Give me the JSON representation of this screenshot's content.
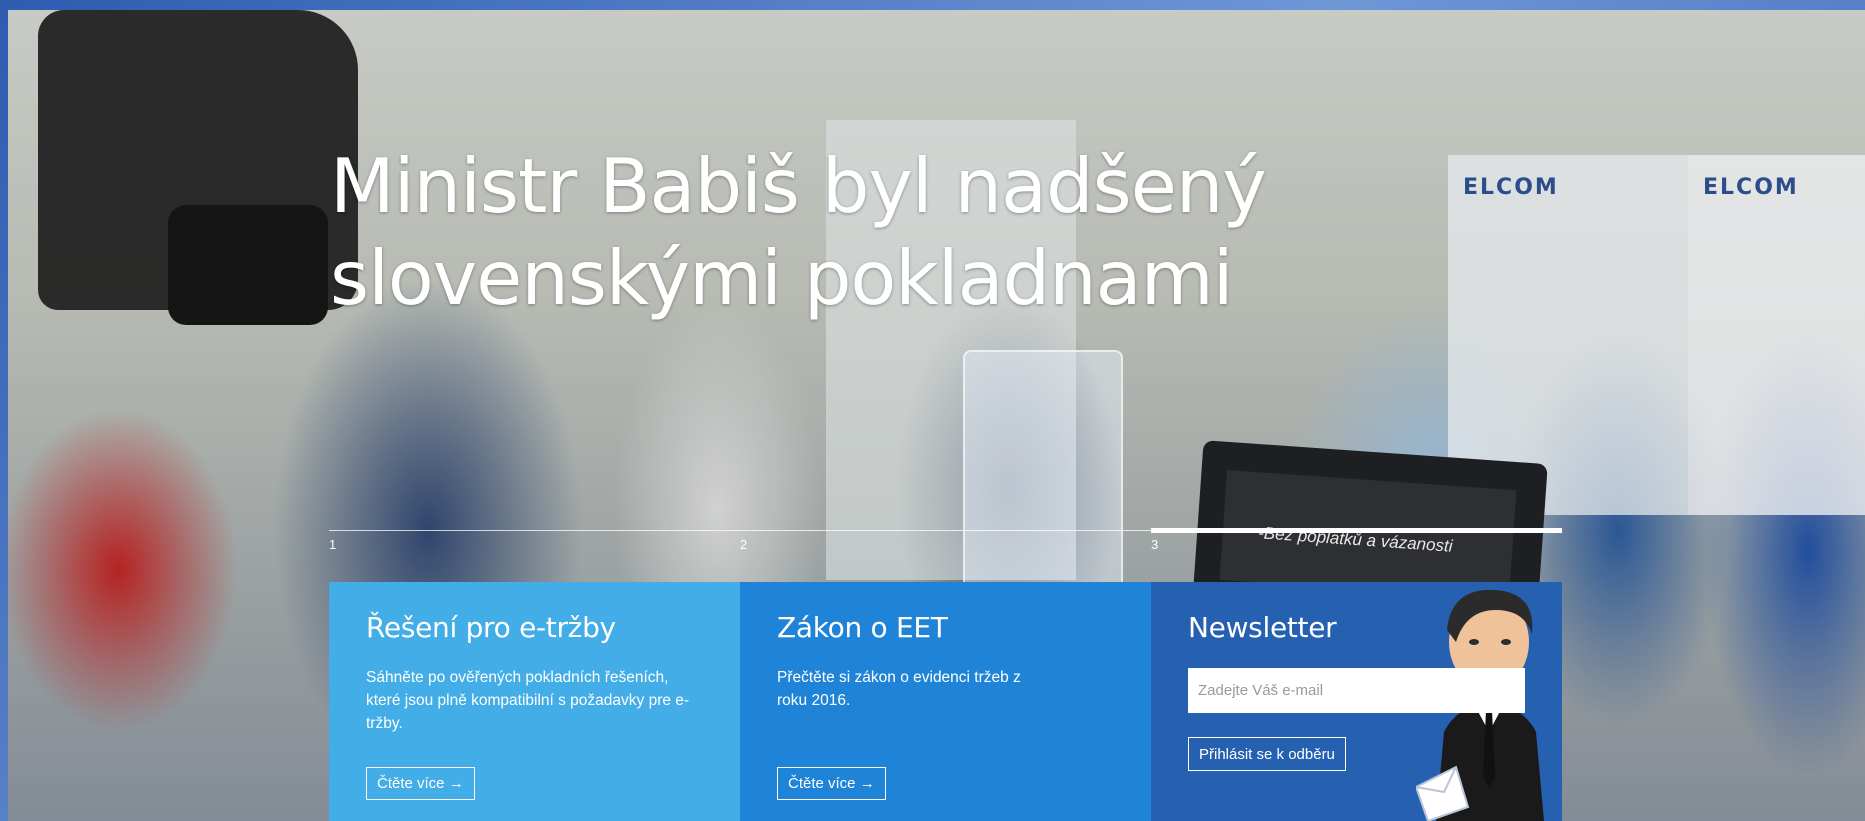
{
  "hero": {
    "title": "Ministr Babiš byl nadšený slovenskými pokladnami",
    "photo_brand_text": "ELCOM",
    "laptop_text": "-Bez poplatků a vázanosti"
  },
  "slider": {
    "tabs": [
      {
        "number": "1",
        "active": false
      },
      {
        "number": "2",
        "active": false
      },
      {
        "number": "3",
        "active": true
      }
    ]
  },
  "panels": {
    "solutions": {
      "title": "Řešení pro e-tržby",
      "text": "Sáhněte po ověřených pokladních řešeních, které jsou plně kompatibilní s požadavky pre e-tržby.",
      "button": "Čtěte více →"
    },
    "law": {
      "title": "Zákon o EET",
      "text": "Přečtěte si zákon o evidenci tržeb z roku 2016.",
      "button": "Čtěte více →"
    },
    "newsletter": {
      "title": "Newsletter",
      "email_placeholder": "Zadejte Váš e-mail",
      "button": "Přihlásit se k odběru"
    }
  },
  "colors": {
    "panel_solutions": "#42ade6",
    "panel_law": "#1f84d7",
    "panel_newsletter": "#2660b1"
  }
}
